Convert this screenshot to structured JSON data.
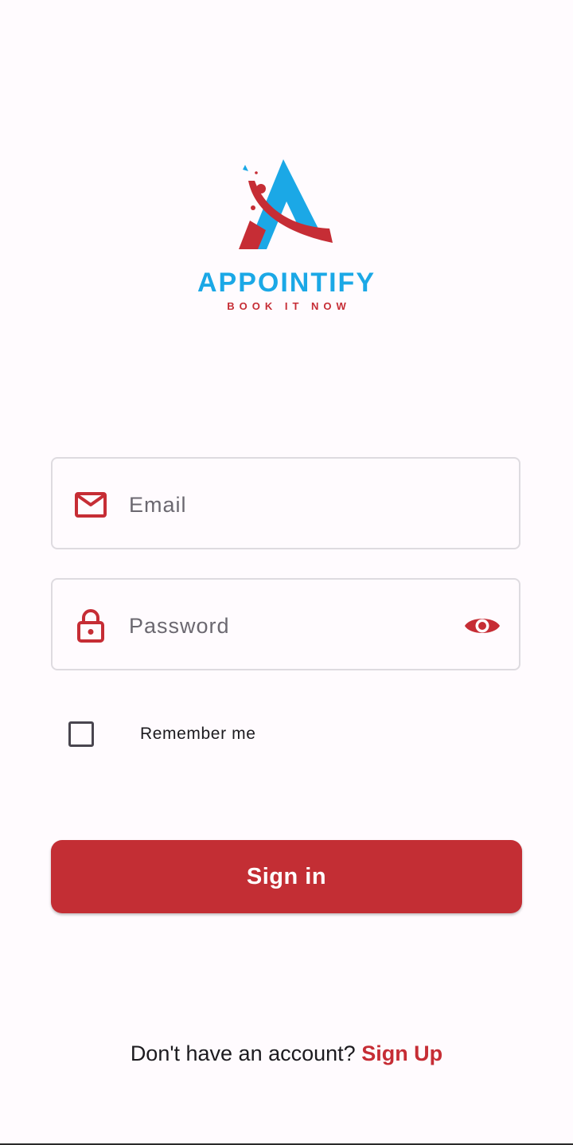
{
  "brand": {
    "name": "APPOINTIFY",
    "tagline": "BOOK IT NOW",
    "primary_color": "#1ba8e6",
    "accent_color": "#c62d35"
  },
  "form": {
    "email": {
      "placeholder": "Email",
      "value": "",
      "icon": "mail-icon"
    },
    "password": {
      "placeholder": "Password",
      "value": "",
      "icon": "lock-icon",
      "toggle_icon": "eye-icon"
    },
    "remember": {
      "label": "Remember me",
      "checked": false
    },
    "submit_label": "Sign in"
  },
  "footer": {
    "prompt": "Don't have an account?",
    "link_label": "Sign Up"
  }
}
